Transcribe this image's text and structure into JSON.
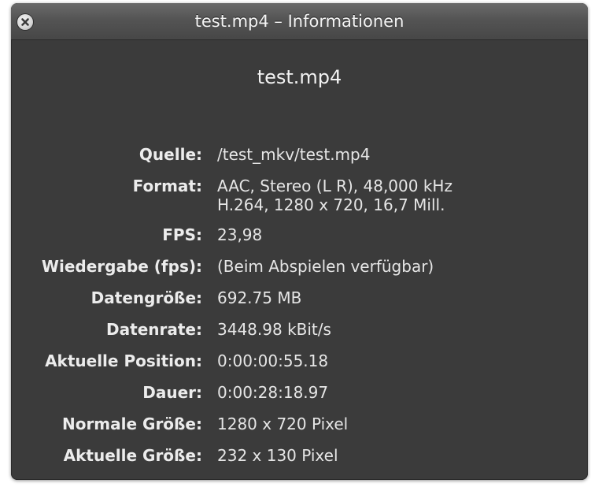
{
  "window": {
    "title": "test.mp4 – Informationen",
    "close_icon": "close-icon"
  },
  "header": {
    "filename": "test.mp4"
  },
  "info": {
    "source": {
      "label": "Quelle:",
      "value": "/test_mkv/test.mp4"
    },
    "format": {
      "label": "Format:",
      "value_line1": "AAC, Stereo (L R), 48,000 kHz",
      "value_line2": "H.264, 1280 x 720, 16,7 Mill."
    },
    "fps": {
      "label": "FPS:",
      "value": "23,98"
    },
    "playback_fps": {
      "label": "Wiedergabe (fps):",
      "value": "(Beim Abspielen verfügbar)"
    },
    "data_size": {
      "label": "Datengröße:",
      "value": "692.75 MB"
    },
    "data_rate": {
      "label": "Datenrate:",
      "value": "3448.98 kBit/s"
    },
    "current_position": {
      "label": "Aktuelle Position:",
      "value": "0:00:00:55.18"
    },
    "duration": {
      "label": "Dauer:",
      "value": "0:00:28:18.97"
    },
    "normal_size": {
      "label": "Normale Größe:",
      "value": "1280 x 720 Pixel"
    },
    "current_size": {
      "label": "Aktuelle Größe:",
      "value": "232 x 130 Pixel"
    }
  },
  "colors": {
    "panel_background": "#3b3b3b",
    "titlebar_top": "#6a6a6a",
    "titlebar_bottom": "#474747",
    "text": "#e8e8e8"
  }
}
